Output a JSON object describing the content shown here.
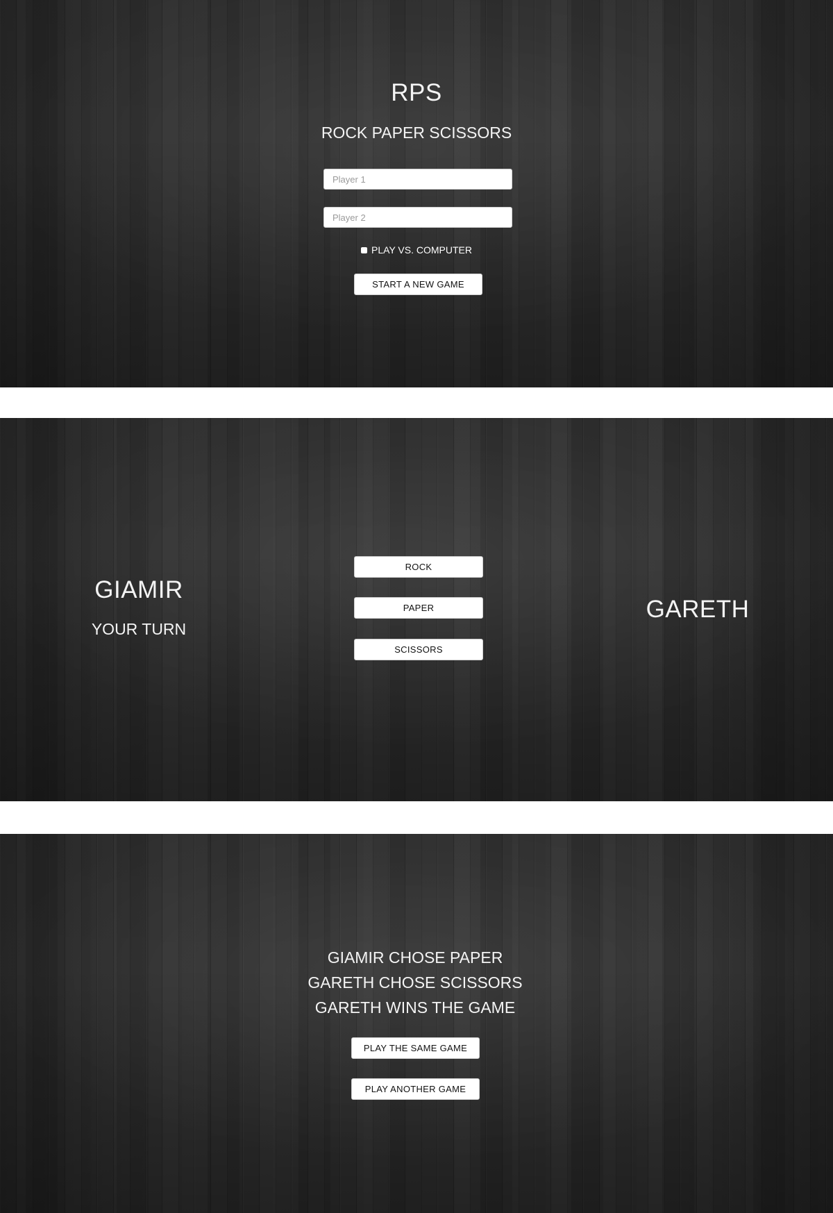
{
  "setup": {
    "title": "RPS",
    "subtitle": "ROCK PAPER SCISSORS",
    "player1_placeholder": "Player 1",
    "player2_placeholder": "Player 2",
    "vs_computer_label": "PLAY VS. COMPUTER",
    "vs_computer_checked": false,
    "start_button": "START A NEW GAME"
  },
  "turn": {
    "player1_name": "GIAMIR",
    "player1_status": "YOUR TURN",
    "player2_name": "GARETH",
    "choices": [
      "ROCK",
      "PAPER",
      "SCISSORS"
    ]
  },
  "result": {
    "lines": [
      "GIAMIR CHOSE PAPER",
      "GARETH CHOSE SCISSORS",
      "GARETH WINS THE GAME"
    ],
    "play_same_button": "PLAY THE SAME GAME",
    "play_another_button": "PLAY ANOTHER GAME"
  },
  "colors": {
    "background": "#2e2e2e",
    "text": "#f4f4f4",
    "button_bg": "#ffffff",
    "page_gap": "#ffffff"
  }
}
